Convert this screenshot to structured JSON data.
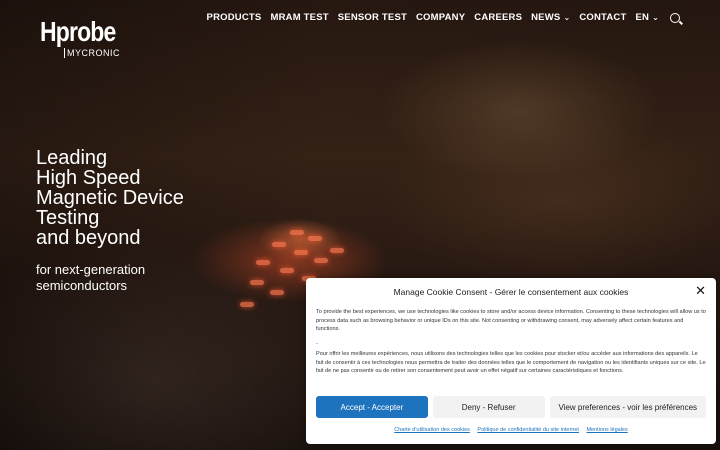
{
  "logo": {
    "main": "Hprobe",
    "sub": "MYCRONIC"
  },
  "nav": {
    "items": [
      {
        "label": "PRODUCTS"
      },
      {
        "label": "MRAM TEST"
      },
      {
        "label": "SENSOR TEST"
      },
      {
        "label": "COMPANY"
      },
      {
        "label": "CAREERS"
      },
      {
        "label": "NEWS"
      },
      {
        "label": "CONTACT"
      },
      {
        "label": "EN"
      }
    ]
  },
  "hero": {
    "headline_lines": [
      "Leading",
      "High Speed",
      "Magnetic Device",
      "Testing",
      "and beyond"
    ],
    "subline_lines": [
      "for next-generation",
      "semiconductors"
    ]
  },
  "cookie": {
    "title": "Manage Cookie Consent - Gérer le consentement aux cookies",
    "text_en": "To provide the best experiences, we use technologies like cookies to store and/or access device information. Consenting to these technologies will allow us to process data such as browsing behavior or unique IDs on this site. Not consenting or withdrawing consent, may adversely affect certain features and functions.",
    "separator": "-",
    "text_fr": "Pour offrir les meilleures expériences, nous utilisons des technologies telles que les cookies pour stocker et/ou accéder aux informations des appareils. Le fait de consentir à ces technologies nous permettra de traiter des données telles que le comportement de navigation ou les identifiants uniques sur ce site. Le fait de ne pas consentir ou de retirer son consentement peut avoir un effet négatif sur certaines caractéristiques et fonctions.",
    "accept_label": "Accept - Accepter",
    "deny_label": "Deny - Refuser",
    "prefs_label": "View preferences - voir les préférences",
    "links": [
      "Charte d'utilisation des cookies",
      "Politique de confidentialité du site internet",
      "Mentions légales"
    ]
  },
  "colors": {
    "accent": "#1e73be"
  }
}
